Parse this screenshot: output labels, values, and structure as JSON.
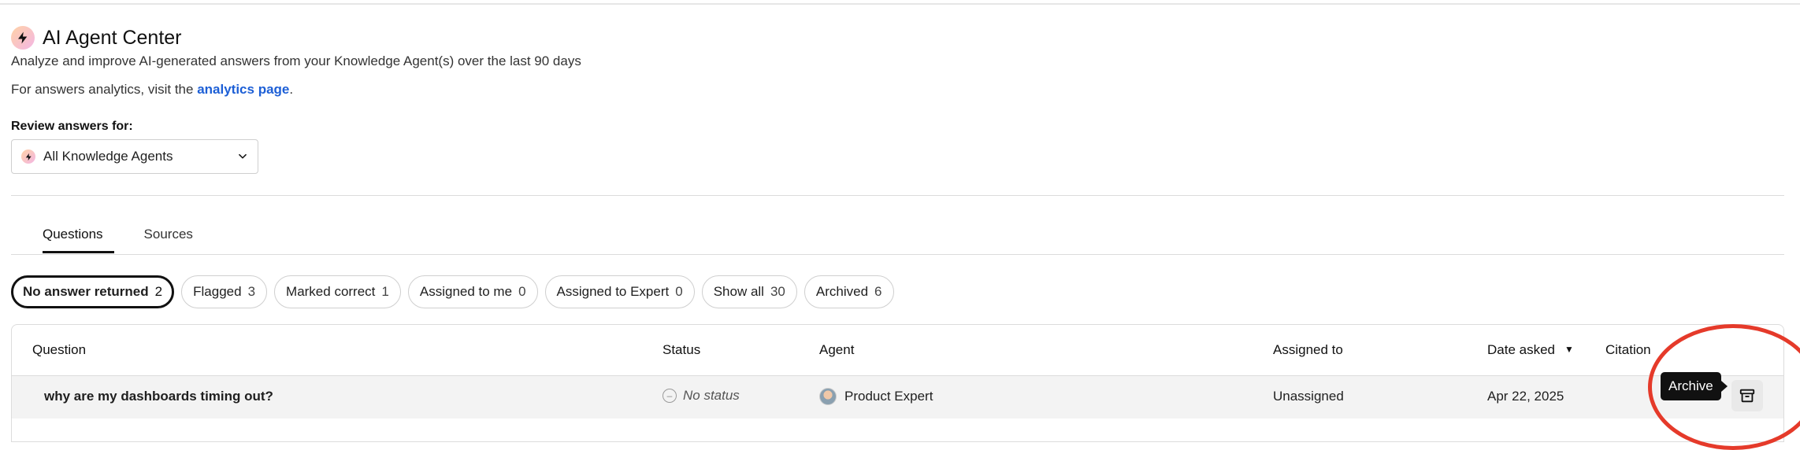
{
  "header": {
    "title": "AI Agent Center",
    "subtitle": "Analyze and improve AI-generated answers from your Knowledge Agent(s) over the last 90 days",
    "analytics_prefix": "For answers analytics, visit the ",
    "analytics_link": "analytics page",
    "analytics_suffix": "."
  },
  "review": {
    "label": "Review answers for:",
    "selected_agent": "All Knowledge Agents"
  },
  "tabs": [
    {
      "label": "Questions",
      "active": true
    },
    {
      "label": "Sources",
      "active": false
    }
  ],
  "filters": [
    {
      "label": "No answer returned",
      "count": "2",
      "selected": true
    },
    {
      "label": "Flagged",
      "count": "3"
    },
    {
      "label": "Marked correct",
      "count": "1"
    },
    {
      "label": "Assigned to me",
      "count": "0"
    },
    {
      "label": "Assigned to Expert",
      "count": "0"
    },
    {
      "label": "Show all",
      "count": "30"
    },
    {
      "label": "Archived",
      "count": "6"
    }
  ],
  "table": {
    "columns": [
      "Question",
      "Status",
      "Agent",
      "Assigned to",
      "Date asked",
      "Citation"
    ],
    "rows": [
      {
        "question": "why are my dashboards timing out?",
        "status": "No status",
        "agent": "Product Expert",
        "assigned_to": "Unassigned",
        "date_asked": "Apr 22, 2025"
      }
    ]
  },
  "tooltip": {
    "text": "Archive"
  },
  "icons": {
    "app": "lightning-bolt-icon",
    "dropdown": "chevron-down-icon",
    "sort": "caret-down-icon",
    "archive": "archive-box-icon",
    "status": "minus-circle-icon"
  },
  "colors": {
    "link": "#1d5fd6",
    "highlight": "#e53a2a",
    "tooltip_bg": "#111111"
  }
}
